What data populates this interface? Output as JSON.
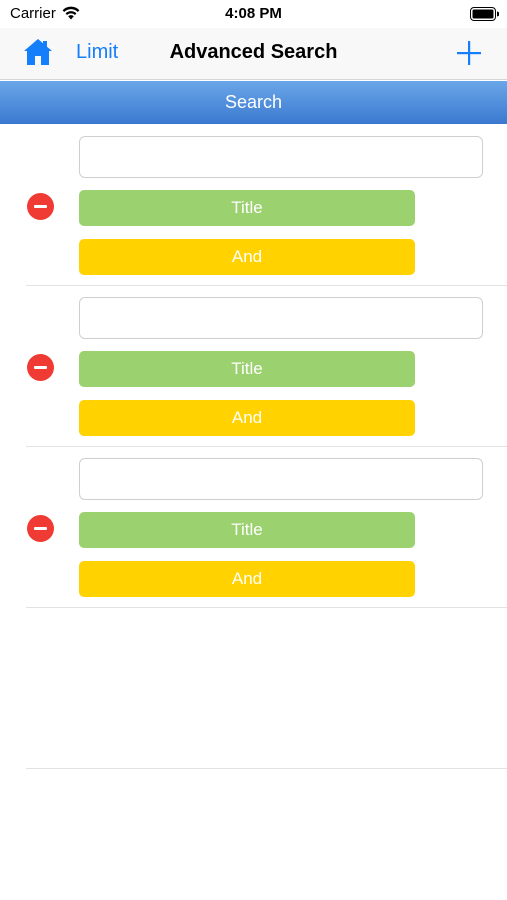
{
  "status_bar": {
    "carrier": "Carrier",
    "time": "4:08 PM",
    "wifi_icon": "wifi-icon",
    "battery_icon": "battery-icon"
  },
  "nav_bar": {
    "home_icon": "home-icon",
    "limit_label": "Limit",
    "title": "Advanced Search",
    "add_icon": "plus-icon"
  },
  "search_bar": {
    "label": "Search"
  },
  "criteria": [
    {
      "text_value": "",
      "field_label": "Title",
      "operator_label": "And"
    },
    {
      "text_value": "",
      "field_label": "Title",
      "operator_label": "And"
    },
    {
      "text_value": "",
      "field_label": "Title",
      "operator_label": "And"
    }
  ],
  "colors": {
    "accent": "#147efb",
    "field_button": "#9bd16e",
    "operator_button": "#ffd200",
    "remove_button": "#ef3b34",
    "search_bar_top": "#6aa6e8",
    "search_bar_bottom": "#3b79d0"
  }
}
